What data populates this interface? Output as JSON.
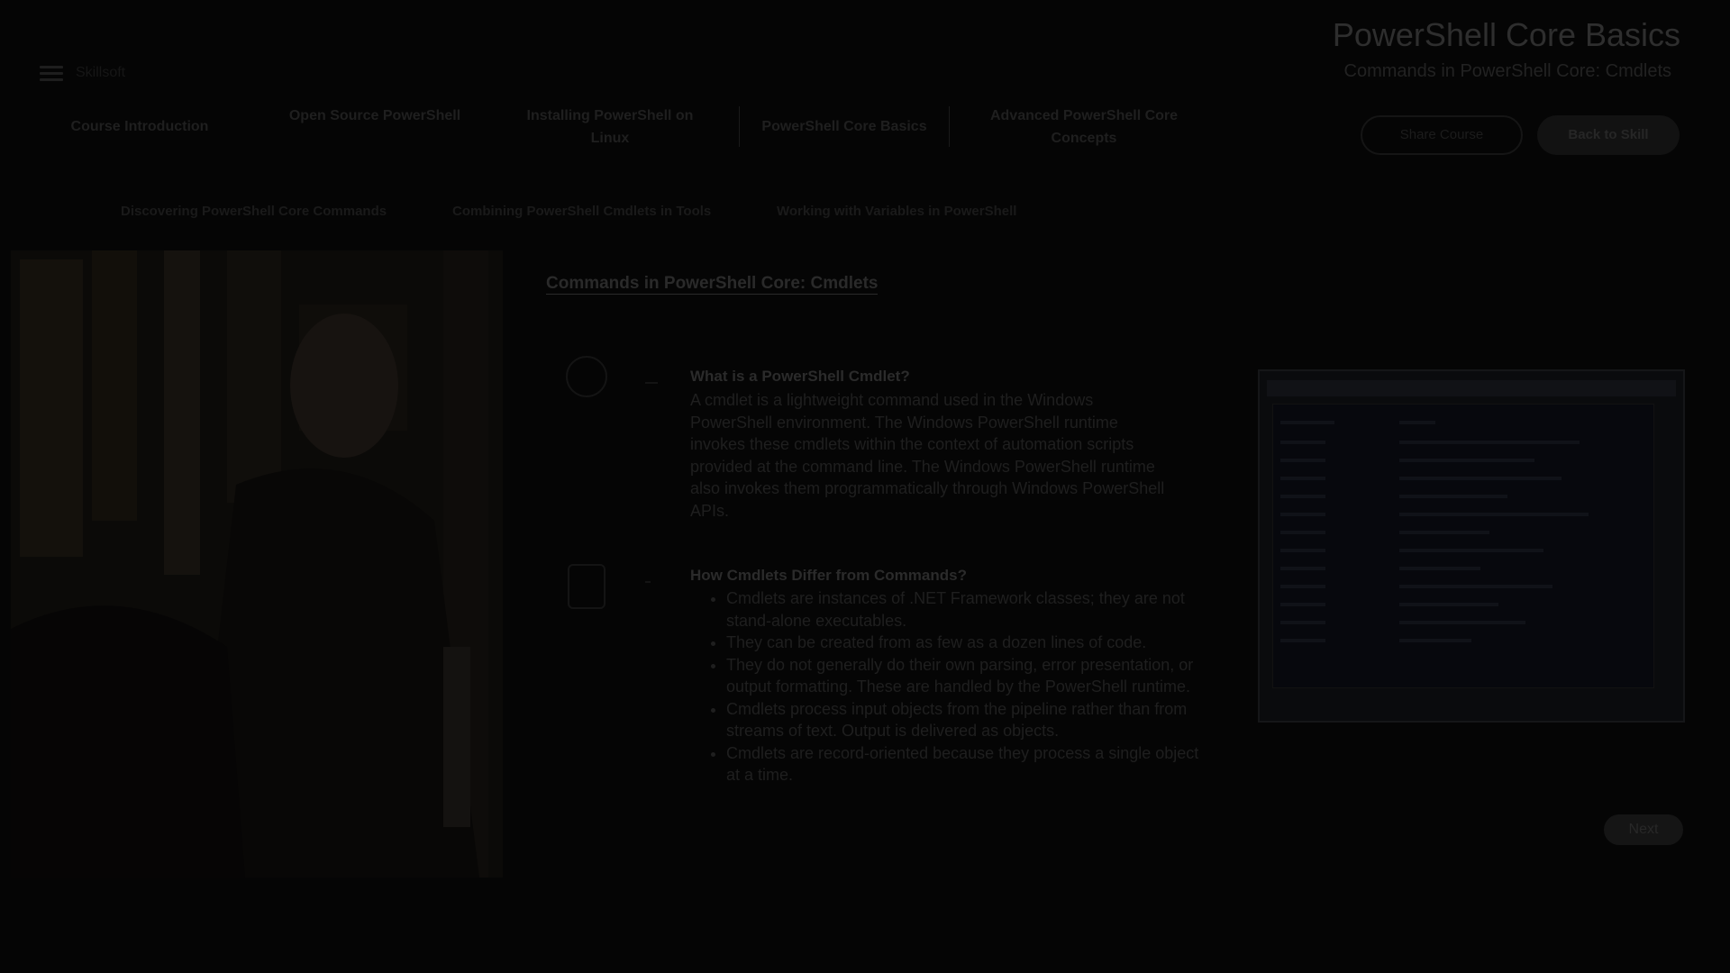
{
  "header": {
    "brand": "Skillsoft",
    "course_title": "PowerShell Core Basics",
    "course_subtitle": "Commands in PowerShell Core: Cmdlets"
  },
  "nav": {
    "items": [
      {
        "label": "Course Introduction"
      },
      {
        "label": "Open Source PowerShell"
      },
      {
        "label": "Installing PowerShell on Linux"
      },
      {
        "label": "PowerShell Core Basics",
        "active": true
      },
      {
        "label": "Advanced PowerShell Core Concepts"
      }
    ],
    "outline_button": "Share Course",
    "primary_button": "Back to Skill"
  },
  "subnav": {
    "items": [
      "Discovering PowerShell Core Commands",
      "Combining PowerShell Cmdlets in Tools",
      "Working with Variables in PowerShell"
    ]
  },
  "content": {
    "section_title": "Commands in PowerShell Core: Cmdlets",
    "block1": {
      "heading": "What is a PowerShell Cmdlet?",
      "text": "A cmdlet is a lightweight command used in the Windows PowerShell environment. The Windows PowerShell runtime invokes these cmdlets within the context of automation scripts provided at the command line. The Windows PowerShell runtime also invokes them programmatically through Windows PowerShell APIs."
    },
    "block2": {
      "heading": "How Cmdlets Differ from Commands?",
      "bullets": [
        "Cmdlets are instances of .NET Framework classes; they are not stand-alone executables.",
        "They can be created from as few as a dozen lines of code.",
        "They do not generally do their own parsing, error presentation, or output formatting. These are handled by the PowerShell runtime.",
        "Cmdlets process input objects from the pipeline rather than from streams of text. Output is delivered as objects.",
        "Cmdlets are record-oriented because they process a single object at a time."
      ]
    },
    "next_button": "Next"
  },
  "icons": {
    "menu": "hamburger-menu-icon",
    "block1": "question-bubble-icon",
    "block2": "clipboard-icon"
  }
}
